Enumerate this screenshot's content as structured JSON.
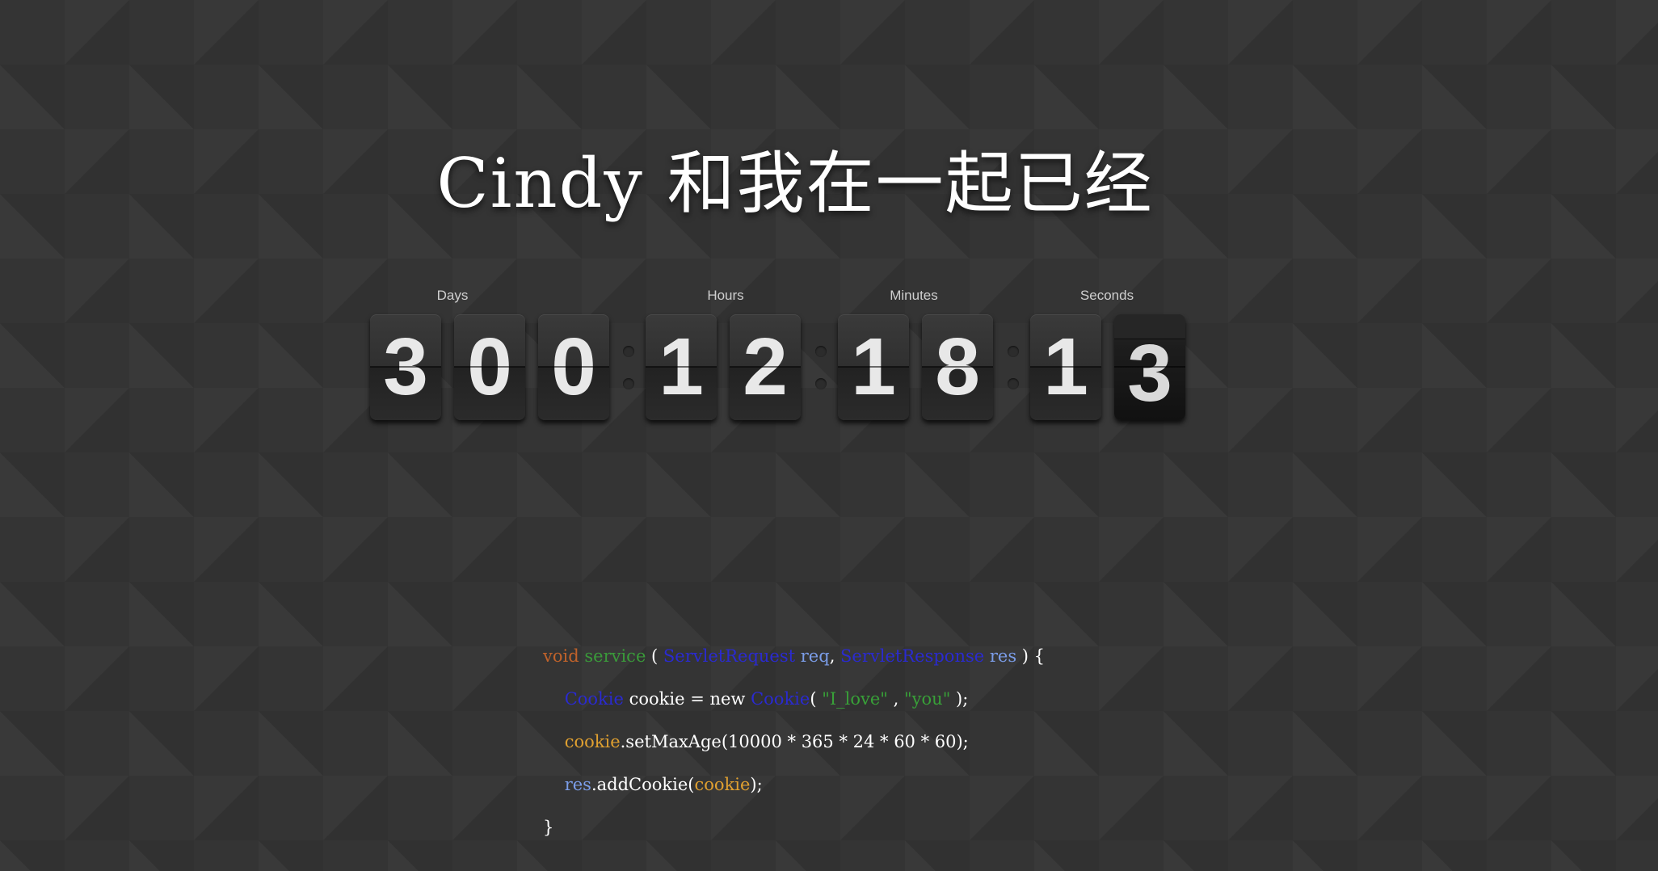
{
  "title": "Cindy 和我在一起已经",
  "counter": {
    "labels": {
      "days": "Days",
      "hours": "Hours",
      "minutes": "Minutes",
      "seconds": "Seconds"
    },
    "days": [
      "3",
      "0",
      "0"
    ],
    "hours": [
      "1",
      "2"
    ],
    "minutes": [
      "1",
      "8"
    ],
    "seconds": [
      "1",
      "3"
    ]
  },
  "code": {
    "line1": {
      "kw": "void",
      "fn": "service",
      "p1": " ( ",
      "t1": "ServletRequest",
      "v1": "req",
      "sep": ", ",
      "t2": "ServletResponse",
      "v2": "res",
      "p2": " ) {"
    },
    "line2": {
      "t1": "Cookie",
      "mid": " cookie = new ",
      "t2": "Cookie",
      "p1": "( ",
      "s1": "\"I_love\"",
      "p2": " , ",
      "s2": "\"you\"",
      "p3": " );"
    },
    "line3": {
      "obj": "cookie",
      "rest": ".setMaxAge(10000 * 365 * 24 * 60 * 60);"
    },
    "line4": {
      "obj": "res",
      "mid": ".addCookie(",
      "arg": "cookie",
      "end": ");"
    },
    "line5": "}"
  }
}
